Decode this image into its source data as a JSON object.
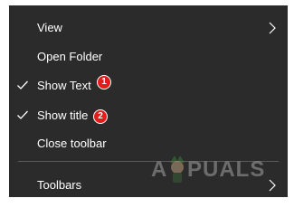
{
  "menu": {
    "items": [
      {
        "label": "View",
        "checked": false,
        "submenu": true
      },
      {
        "label": "Open Folder",
        "checked": false,
        "submenu": false
      },
      {
        "label": "Show Text",
        "checked": true,
        "submenu": false
      },
      {
        "label": "Show title",
        "checked": true,
        "submenu": false
      },
      {
        "label": "Close toolbar",
        "checked": false,
        "submenu": false
      },
      {
        "label": "Toolbars",
        "checked": false,
        "submenu": true
      }
    ]
  },
  "annotations": {
    "badge_1": "1",
    "badge_2": "2",
    "color": "#e21b1b"
  },
  "watermark": {
    "left_part": "A",
    "right_part": "PUALS"
  },
  "colors": {
    "menu_background": "#2b2b2b",
    "text": "#ffffff",
    "divider": "#5a5a5a"
  }
}
